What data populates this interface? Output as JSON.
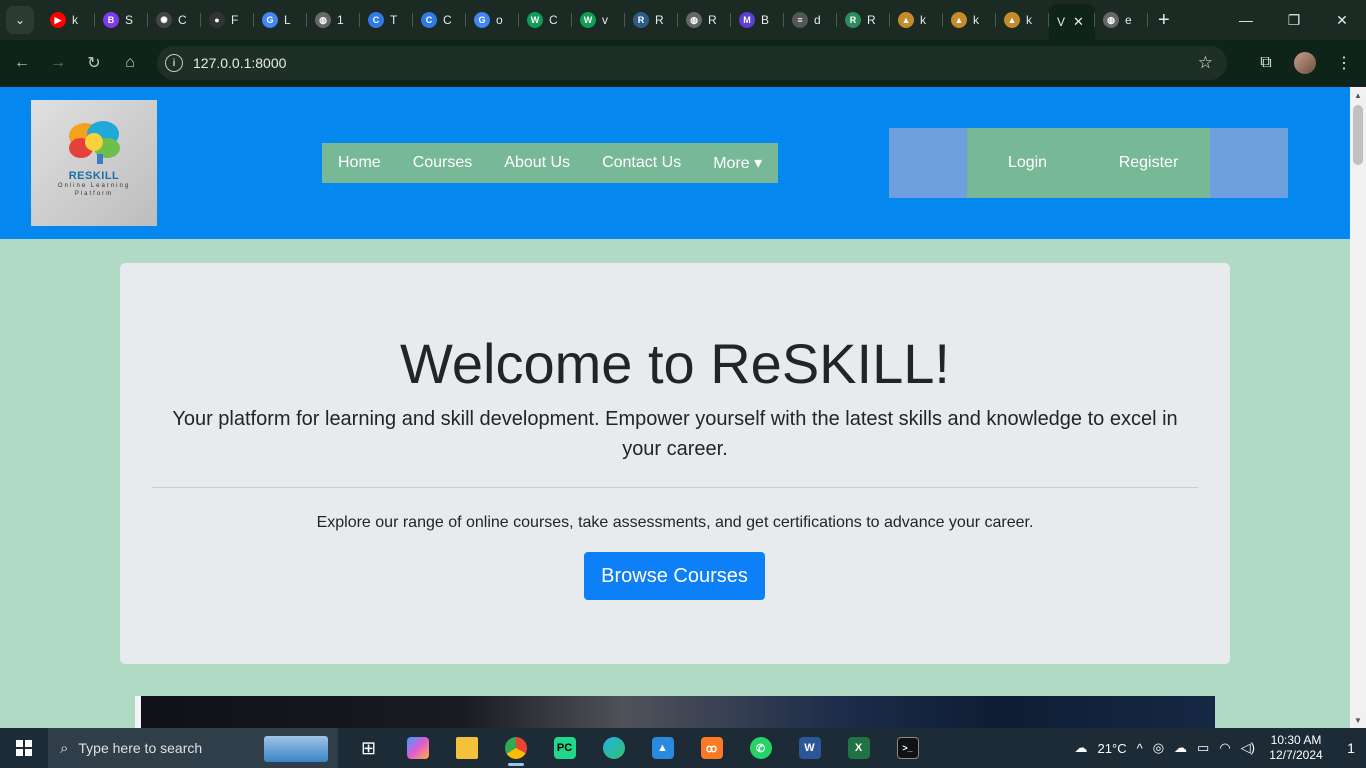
{
  "browser": {
    "tabs": [
      {
        "title": "k",
        "favicon": "youtube-icon",
        "color": "#ff0000",
        "glyph": "▶"
      },
      {
        "title": "S",
        "favicon": "b-icon",
        "color": "#7c3aed",
        "glyph": "B"
      },
      {
        "title": "C",
        "favicon": "openai-icon",
        "color": "#444",
        "glyph": "✺"
      },
      {
        "title": "F",
        "favicon": "github-icon",
        "color": "#333",
        "glyph": "●"
      },
      {
        "title": "L",
        "favicon": "google-icon",
        "color": "#4285f4",
        "glyph": "G"
      },
      {
        "title": "1",
        "favicon": "globe-icon",
        "color": "#666",
        "glyph": "◍"
      },
      {
        "title": "T",
        "favicon": "c-circle-icon",
        "color": "#2f7ae5",
        "glyph": "C"
      },
      {
        "title": "C",
        "favicon": "c-circle-icon",
        "color": "#2f7ae5",
        "glyph": "C"
      },
      {
        "title": "o",
        "favicon": "google-icon",
        "color": "#4285f4",
        "glyph": "G"
      },
      {
        "title": "C",
        "favicon": "w-icon",
        "color": "#0f9d58",
        "glyph": "W"
      },
      {
        "title": "v",
        "favicon": "w-icon",
        "color": "#0f9d58",
        "glyph": "W"
      },
      {
        "title": "R",
        "favicon": "rs-icon",
        "color": "#2e5c8a",
        "glyph": "R"
      },
      {
        "title": "R",
        "favicon": "globe-icon",
        "color": "#666",
        "glyph": "◍"
      },
      {
        "title": "B",
        "favicon": "m-icon",
        "color": "#5b3fd6",
        "glyph": "M"
      },
      {
        "title": "d",
        "favicon": "db-icon",
        "color": "#555",
        "glyph": "≡"
      },
      {
        "title": "R",
        "favicon": "rs-icon",
        "color": "#2e8a5c",
        "glyph": "R"
      },
      {
        "title": "k",
        "favicon": "mountain-icon",
        "color": "#c58a2a",
        "glyph": "▲"
      },
      {
        "title": "k",
        "favicon": "mountain-icon",
        "color": "#c58a2a",
        "glyph": "▲"
      },
      {
        "title": "k",
        "favicon": "mountain-icon",
        "color": "#c58a2a",
        "glyph": "▲"
      }
    ],
    "active_tab_title": "V",
    "after_tab": {
      "title": "e",
      "favicon": "globe-icon",
      "color": "#666",
      "glyph": "◍"
    },
    "url": "127.0.0.1:8000"
  },
  "site": {
    "logo_title": "RESKILL",
    "logo_subtitle": "Online Learning Platform",
    "nav": [
      "Home",
      "Courses",
      "About Us",
      "Contact Us",
      "More ▾"
    ],
    "login_label": "Login",
    "register_label": "Register",
    "colors": {
      "header": "#0487ef",
      "nav": "#77b896",
      "page": "#b0dac3",
      "button": "#0d7ff7"
    }
  },
  "hero": {
    "heading": "Welcome to ReSKILL!",
    "lead": "Your platform for learning and skill development. Empower yourself with the latest skills and knowledge to excel in your career.",
    "description": "Explore our range of online courses, take assessments, and get certifications to advance your career.",
    "button_label": "Browse Courses"
  },
  "taskbar": {
    "search_placeholder": "Type here to search",
    "temperature": "21°C",
    "time": "10:30 AM",
    "date": "12/7/2024",
    "notification_count": "1"
  }
}
